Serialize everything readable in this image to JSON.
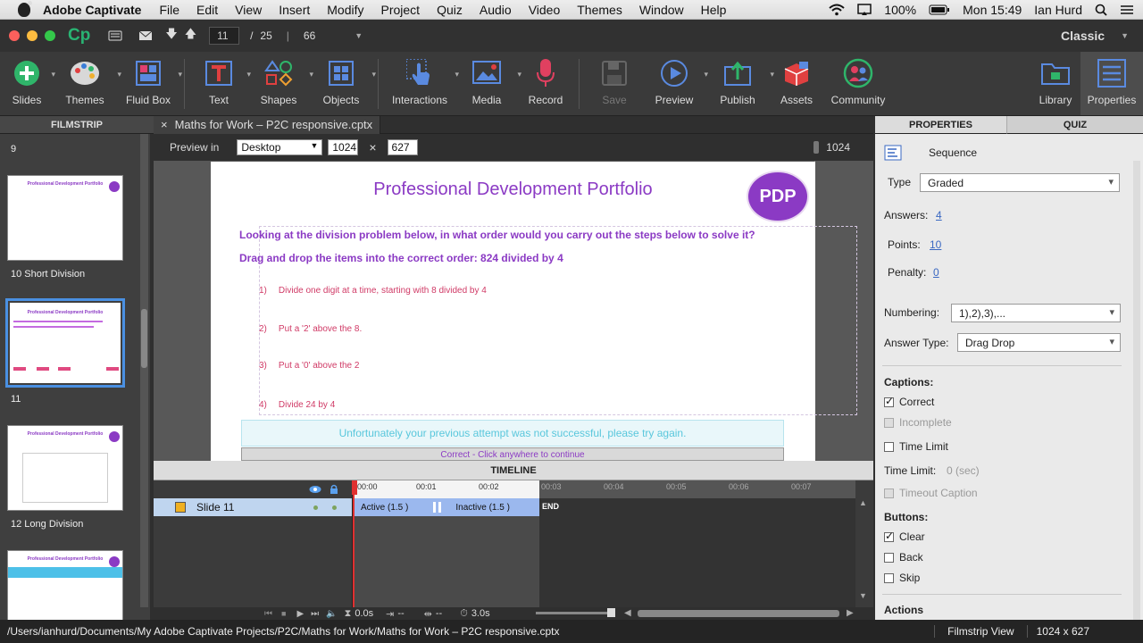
{
  "menubar": {
    "app": "Adobe Captivate",
    "items": [
      "File",
      "Edit",
      "View",
      "Insert",
      "Modify",
      "Project",
      "Quiz",
      "Audio",
      "Video",
      "Themes",
      "Window",
      "Help"
    ],
    "battery": "100%",
    "clock": "Mon 15:49",
    "user": "Ian Hurd"
  },
  "titlebar": {
    "logo": "Cp",
    "slide_current": "11",
    "slide_sep": "/",
    "slide_total": "25",
    "zoom": "66",
    "workspace": "Classic"
  },
  "toolbar": [
    {
      "label": "Slides",
      "icon": "plus-circle-icon"
    },
    {
      "label": "Themes",
      "icon": "palette-icon"
    },
    {
      "label": "Fluid Box",
      "icon": "fluid-box-icon"
    },
    {
      "label": "Text",
      "icon": "text-icon"
    },
    {
      "label": "Shapes",
      "icon": "shapes-icon"
    },
    {
      "label": "Objects",
      "icon": "objects-icon"
    },
    {
      "label": "Interactions",
      "icon": "hand-pointer-icon"
    },
    {
      "label": "Media",
      "icon": "image-icon"
    },
    {
      "label": "Record",
      "icon": "microphone-icon"
    },
    {
      "label": "Save",
      "icon": "floppy-icon"
    },
    {
      "label": "Preview",
      "icon": "play-icon"
    },
    {
      "label": "Publish",
      "icon": "publish-icon"
    },
    {
      "label": "Assets",
      "icon": "assets-icon"
    },
    {
      "label": "Community",
      "icon": "community-icon"
    },
    {
      "label": "Library",
      "icon": "library-icon"
    },
    {
      "label": "Properties",
      "icon": "properties-icon"
    }
  ],
  "filmstrip": {
    "title": "FILMSTRIP",
    "slides": [
      {
        "number": "9",
        "label": "9"
      },
      {
        "number": "10",
        "label": "10 Short Division"
      },
      {
        "number": "11",
        "label": "11"
      },
      {
        "number": "12",
        "label": "12 Long Division"
      }
    ]
  },
  "doc_tab": {
    "close": "×",
    "label": "Maths for Work – P2C responsive.cptx"
  },
  "preview": {
    "label": "Preview in",
    "device": "Desktop",
    "width": "1024",
    "height": "627",
    "times": "×",
    "breakpoint": "1024"
  },
  "slide": {
    "title": "Professional Development Portfolio",
    "logo": "PDP",
    "question": "Looking at the division problem below, in what order would you carry out the steps below to solve it?",
    "instruction": "Drag and drop the items into the correct order: 824 divided by 4",
    "steps": [
      {
        "num": "1)",
        "text": "Divide one digit at a time, starting with 8 divided by 4"
      },
      {
        "num": "2)",
        "text": "Put a '2' above the 8."
      },
      {
        "num": "3)",
        "text": "Put a '0' above the 2"
      },
      {
        "num": "4)",
        "text": "Divide 24 by 4"
      }
    ],
    "feedback_fail": "Unfortunately your previous attempt was not successful, please try again.",
    "feedback_correct": "Correct - Click anywhere to continue"
  },
  "timeline": {
    "title": "TIMELINE",
    "ticks": [
      "00:00",
      "00:01",
      "00:02",
      "00:03",
      "00:04",
      "00:05",
      "00:06",
      "00:07"
    ],
    "slide_label": "Slide 11",
    "active": "Active (1.5 )",
    "inactive": "Inactive (1.5 )",
    "end": "END",
    "current_time": "0.0s",
    "dash1": "--",
    "dash2": "--",
    "duration": "3.0s"
  },
  "properties": {
    "tab_properties": "PROPERTIES",
    "tab_quiz": "QUIZ",
    "object_name": "Sequence",
    "type_label": "Type",
    "type_value": "Graded",
    "answers_label": "Answers:",
    "answers_value": "4",
    "points_label": "Points:",
    "points_value": "10",
    "penalty_label": "Penalty:",
    "penalty_value": "0",
    "numbering_label": "Numbering:",
    "numbering_value": "1),2),3),...",
    "answer_type_label": "Answer Type:",
    "answer_type_value": "Drag Drop",
    "captions_label": "Captions:",
    "correct": "Correct",
    "incomplete": "Incomplete",
    "time_limit": "Time Limit",
    "time_limit_label": "Time Limit:",
    "time_limit_value": "0 (sec)",
    "timeout_caption": "Timeout Caption",
    "buttons_label": "Buttons:",
    "clear": "Clear",
    "back": "Back",
    "skip": "Skip",
    "actions_label": "Actions"
  },
  "status": {
    "path": "/Users/ianhurd/Documents/My Adobe Captivate Projects/P2C/Maths for Work/Maths for Work – P2C responsive.cptx",
    "view": "Filmstrip View",
    "size": "1024 x 627"
  }
}
